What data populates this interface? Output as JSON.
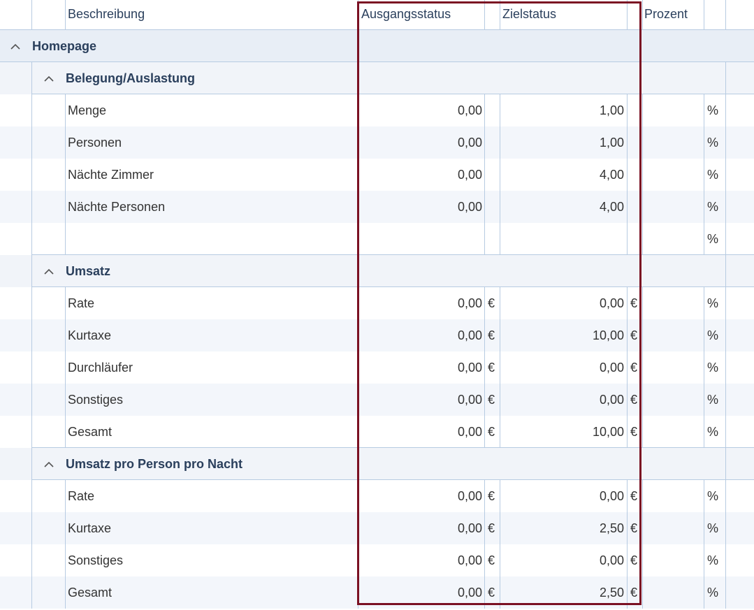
{
  "header": {
    "col_beschreibung": "Beschreibung",
    "col_ausgang": "Ausgangsstatus",
    "col_ziel": "Zielstatus",
    "col_prozent": "Prozent"
  },
  "group": {
    "title": "Homepage",
    "sections": [
      {
        "title": "Belegung/Auslastung",
        "rows": [
          {
            "label": "Menge",
            "ausgang": "0,00",
            "ausgang_unit": "",
            "ziel": "1,00",
            "ziel_unit": "",
            "prozent": "",
            "prozent_unit": "%"
          },
          {
            "label": "Personen",
            "ausgang": "0,00",
            "ausgang_unit": "",
            "ziel": "1,00",
            "ziel_unit": "",
            "prozent": "",
            "prozent_unit": "%"
          },
          {
            "label": "Nächte Zimmer",
            "ausgang": "0,00",
            "ausgang_unit": "",
            "ziel": "4,00",
            "ziel_unit": "",
            "prozent": "",
            "prozent_unit": "%"
          },
          {
            "label": "Nächte Personen",
            "ausgang": "0,00",
            "ausgang_unit": "",
            "ziel": "4,00",
            "ziel_unit": "",
            "prozent": "",
            "prozent_unit": "%"
          },
          {
            "label": "",
            "ausgang": "",
            "ausgang_unit": "",
            "ziel": "",
            "ziel_unit": "",
            "prozent": "",
            "prozent_unit": "%"
          }
        ]
      },
      {
        "title": "Umsatz",
        "rows": [
          {
            "label": "Rate",
            "ausgang": "0,00",
            "ausgang_unit": "€",
            "ziel": "0,00",
            "ziel_unit": "€",
            "prozent": "",
            "prozent_unit": "%"
          },
          {
            "label": "Kurtaxe",
            "ausgang": "0,00",
            "ausgang_unit": "€",
            "ziel": "10,00",
            "ziel_unit": "€",
            "prozent": "",
            "prozent_unit": "%"
          },
          {
            "label": "Durchläufer",
            "ausgang": "0,00",
            "ausgang_unit": "€",
            "ziel": "0,00",
            "ziel_unit": "€",
            "prozent": "",
            "prozent_unit": "%"
          },
          {
            "label": "Sonstiges",
            "ausgang": "0,00",
            "ausgang_unit": "€",
            "ziel": "0,00",
            "ziel_unit": "€",
            "prozent": "",
            "prozent_unit": "%"
          },
          {
            "label": "Gesamt",
            "ausgang": "0,00",
            "ausgang_unit": "€",
            "ziel": "10,00",
            "ziel_unit": "€",
            "prozent": "",
            "prozent_unit": "%"
          }
        ]
      },
      {
        "title": "Umsatz pro Person pro Nacht",
        "rows": [
          {
            "label": "Rate",
            "ausgang": "0,00",
            "ausgang_unit": "€",
            "ziel": "0,00",
            "ziel_unit": "€",
            "prozent": "",
            "prozent_unit": "%"
          },
          {
            "label": "Kurtaxe",
            "ausgang": "0,00",
            "ausgang_unit": "€",
            "ziel": "2,50",
            "ziel_unit": "€",
            "prozent": "",
            "prozent_unit": "%"
          },
          {
            "label": "Sonstiges",
            "ausgang": "0,00",
            "ausgang_unit": "€",
            "ziel": "0,00",
            "ziel_unit": "€",
            "prozent": "",
            "prozent_unit": "%"
          },
          {
            "label": "Gesamt",
            "ausgang": "0,00",
            "ausgang_unit": "€",
            "ziel": "2,50",
            "ziel_unit": "€",
            "prozent": "",
            "prozent_unit": "%"
          }
        ]
      }
    ]
  },
  "icons": {
    "collapse": "chevron-up-icon"
  },
  "colors": {
    "highlight_border": "#7b1123",
    "grid_line": "#b7cbe2",
    "group_bg": "#e8eef6",
    "alt_row_bg": "#f3f6fb"
  }
}
